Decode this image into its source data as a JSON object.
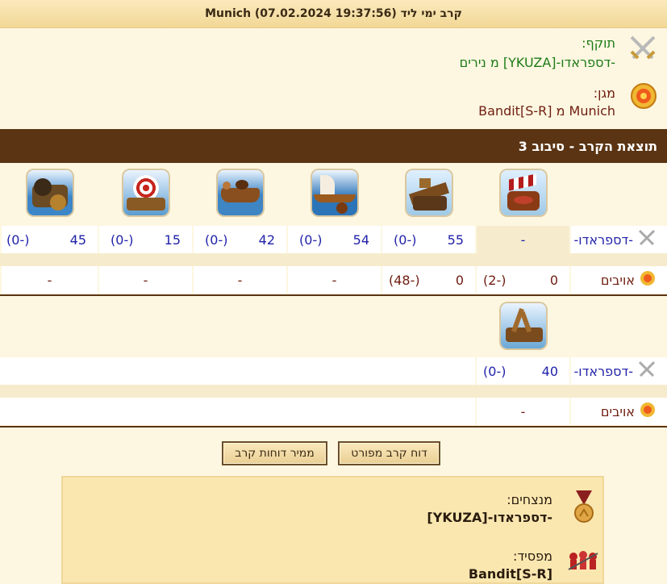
{
  "title": "קרב ימי ליד Munich (07.02.2024 19:37:56)",
  "attacker": {
    "label": "תוקף:",
    "value": "-דספראדו-[YKUZA] מ נירים"
  },
  "defender": {
    "label": "מגן:",
    "value": "Munich מ Bandit[S-R]"
  },
  "round_header": "תוצאת הקרב - סיבוב 3",
  "wave1": {
    "unit_icons": [
      "fire-ship-icon",
      "ram-ship-icon",
      "ballista-ship-icon",
      "paddle-ship-icon",
      "catapult-ship-icon",
      "mortar-ship-icon"
    ],
    "player_name": "-דספראדו-",
    "player_cells": [
      {
        "count": "-",
        "loss": ""
      },
      {
        "count": "55",
        "loss": "(-0)"
      },
      {
        "count": "54",
        "loss": "(-0)"
      },
      {
        "count": "42",
        "loss": "(-0)"
      },
      {
        "count": "15",
        "loss": "(-0)"
      },
      {
        "count": "45",
        "loss": "(-0)"
      }
    ],
    "enemy_name": "אויבים",
    "enemy_cells": [
      {
        "count": "0",
        "loss": "(-2)"
      },
      {
        "count": "0",
        "loss": "(-48)"
      },
      {
        "count": "-",
        "loss": ""
      },
      {
        "count": "-",
        "loss": ""
      },
      {
        "count": "-",
        "loss": ""
      },
      {
        "count": "-",
        "loss": ""
      }
    ]
  },
  "wave2": {
    "unit_icons": [
      "diving-boat-icon"
    ],
    "player_name": "-דספראדו-",
    "player_cells": [
      {
        "count": "40",
        "loss": "(-0)"
      }
    ],
    "enemy_name": "אויבים",
    "enemy_cells": [
      {
        "count": "-",
        "loss": ""
      }
    ]
  },
  "buttons": {
    "detailed": "דוח קרב מפורט",
    "converter": "ממיר דוחות קרב"
  },
  "result": {
    "winners_label": "מנצחים:",
    "winners_value": "-דספראדו-[YKUZA]",
    "loser_label": "מפסיד:",
    "loser_value": "Bandit[S-R]"
  },
  "colors": {
    "band": "#5a3413",
    "player": "#2222aa",
    "enemy": "#6e1d10",
    "attacker": "#1c7a16"
  }
}
